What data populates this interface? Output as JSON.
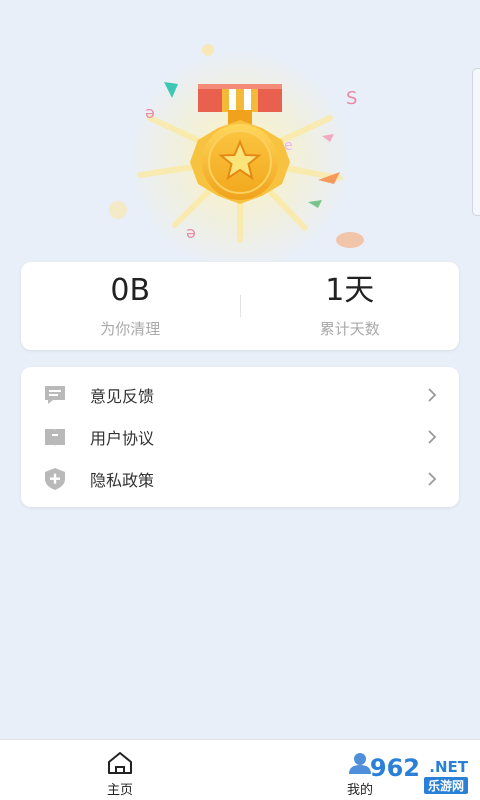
{
  "stats": {
    "cleaned_value": "0B",
    "cleaned_label": "为你清理",
    "days_value": "1天",
    "days_label": "累计天数"
  },
  "menu": {
    "items": [
      {
        "label": "意见反馈",
        "icon": "feedback-chat-icon"
      },
      {
        "label": "用户协议",
        "icon": "agreement-book-icon"
      },
      {
        "label": "隐私政策",
        "icon": "privacy-shield-icon"
      }
    ]
  },
  "tabbar": {
    "tabs": [
      {
        "label": "主页",
        "icon": "home-icon"
      },
      {
        "label": "我的",
        "icon": "profile-icon"
      }
    ]
  },
  "watermark": {
    "brand": "962",
    "domain": ".NET",
    "sub": "乐游网"
  },
  "colors": {
    "background": "#e9eff8",
    "card": "#ffffff",
    "medal_gold": "#f6b92b",
    "ribbon_red": "#e9604f",
    "watermark_blue": "#2a7fd6"
  }
}
